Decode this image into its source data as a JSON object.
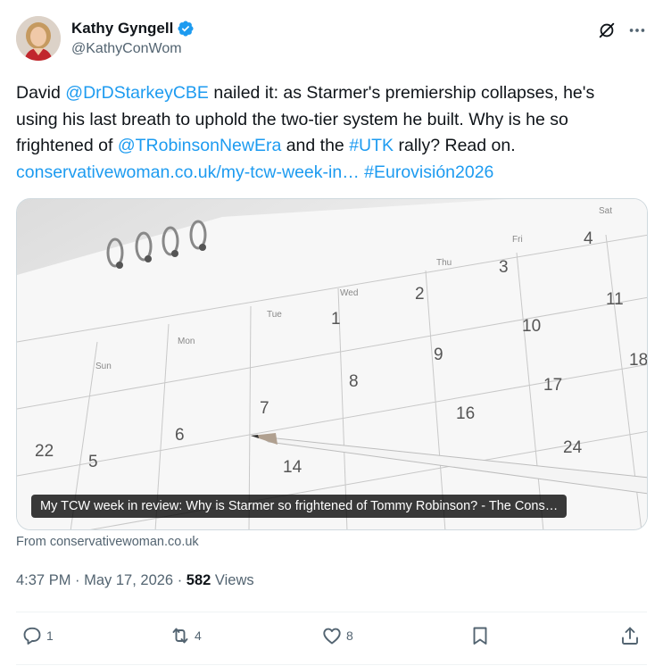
{
  "author": {
    "name": "Kathy Gyngell",
    "handle": "@KathyConWom",
    "verified": true
  },
  "tweet": {
    "t1": "David ",
    "mention1": "@DrDStarkeyCBE",
    "t2": " nailed it: as Starmer's premiership collapses, he's using his last breath to uphold the two-tier system he built. Why is he so frightened of ",
    "mention2": "@TRobinsonNewEra",
    "t3": " and the ",
    "hashtag1": "#UTK",
    "t4": " rally? Read on.",
    "url": "conservativewoman.co.uk/my-tcw-week-in…",
    "hashtag2": "#Eurovisión2026"
  },
  "card": {
    "caption": "My TCW week in review: Why is Starmer so frightened of Tommy Robinson? - The Cons…",
    "source": "From conservativewoman.co.uk",
    "calendar": {
      "days": [
        "Sun",
        "Mon",
        "Tue",
        "Wed",
        "Thu",
        "Fri",
        "Sat"
      ],
      "numbers": [
        "1",
        "2",
        "3",
        "4",
        "5",
        "6",
        "7",
        "8",
        "9",
        "10",
        "11",
        "14",
        "16",
        "17",
        "18",
        "22",
        "24"
      ]
    }
  },
  "meta": {
    "time": "4:37 PM",
    "sep1": " · ",
    "date": "May 17, 2026",
    "sep2": " · ",
    "views_count": "582",
    "views_label": " Views"
  },
  "actions": {
    "replies": "1",
    "reposts": "4",
    "likes": "8"
  },
  "colors": {
    "link": "#1d9bf0",
    "text": "#0f1419",
    "secondary": "#536471",
    "border": "#cfd9de"
  },
  "icons": [
    "verified-badge-icon",
    "grok-icon",
    "more-icon",
    "reply-icon",
    "repost-icon",
    "like-icon",
    "bookmark-icon",
    "share-icon"
  ]
}
